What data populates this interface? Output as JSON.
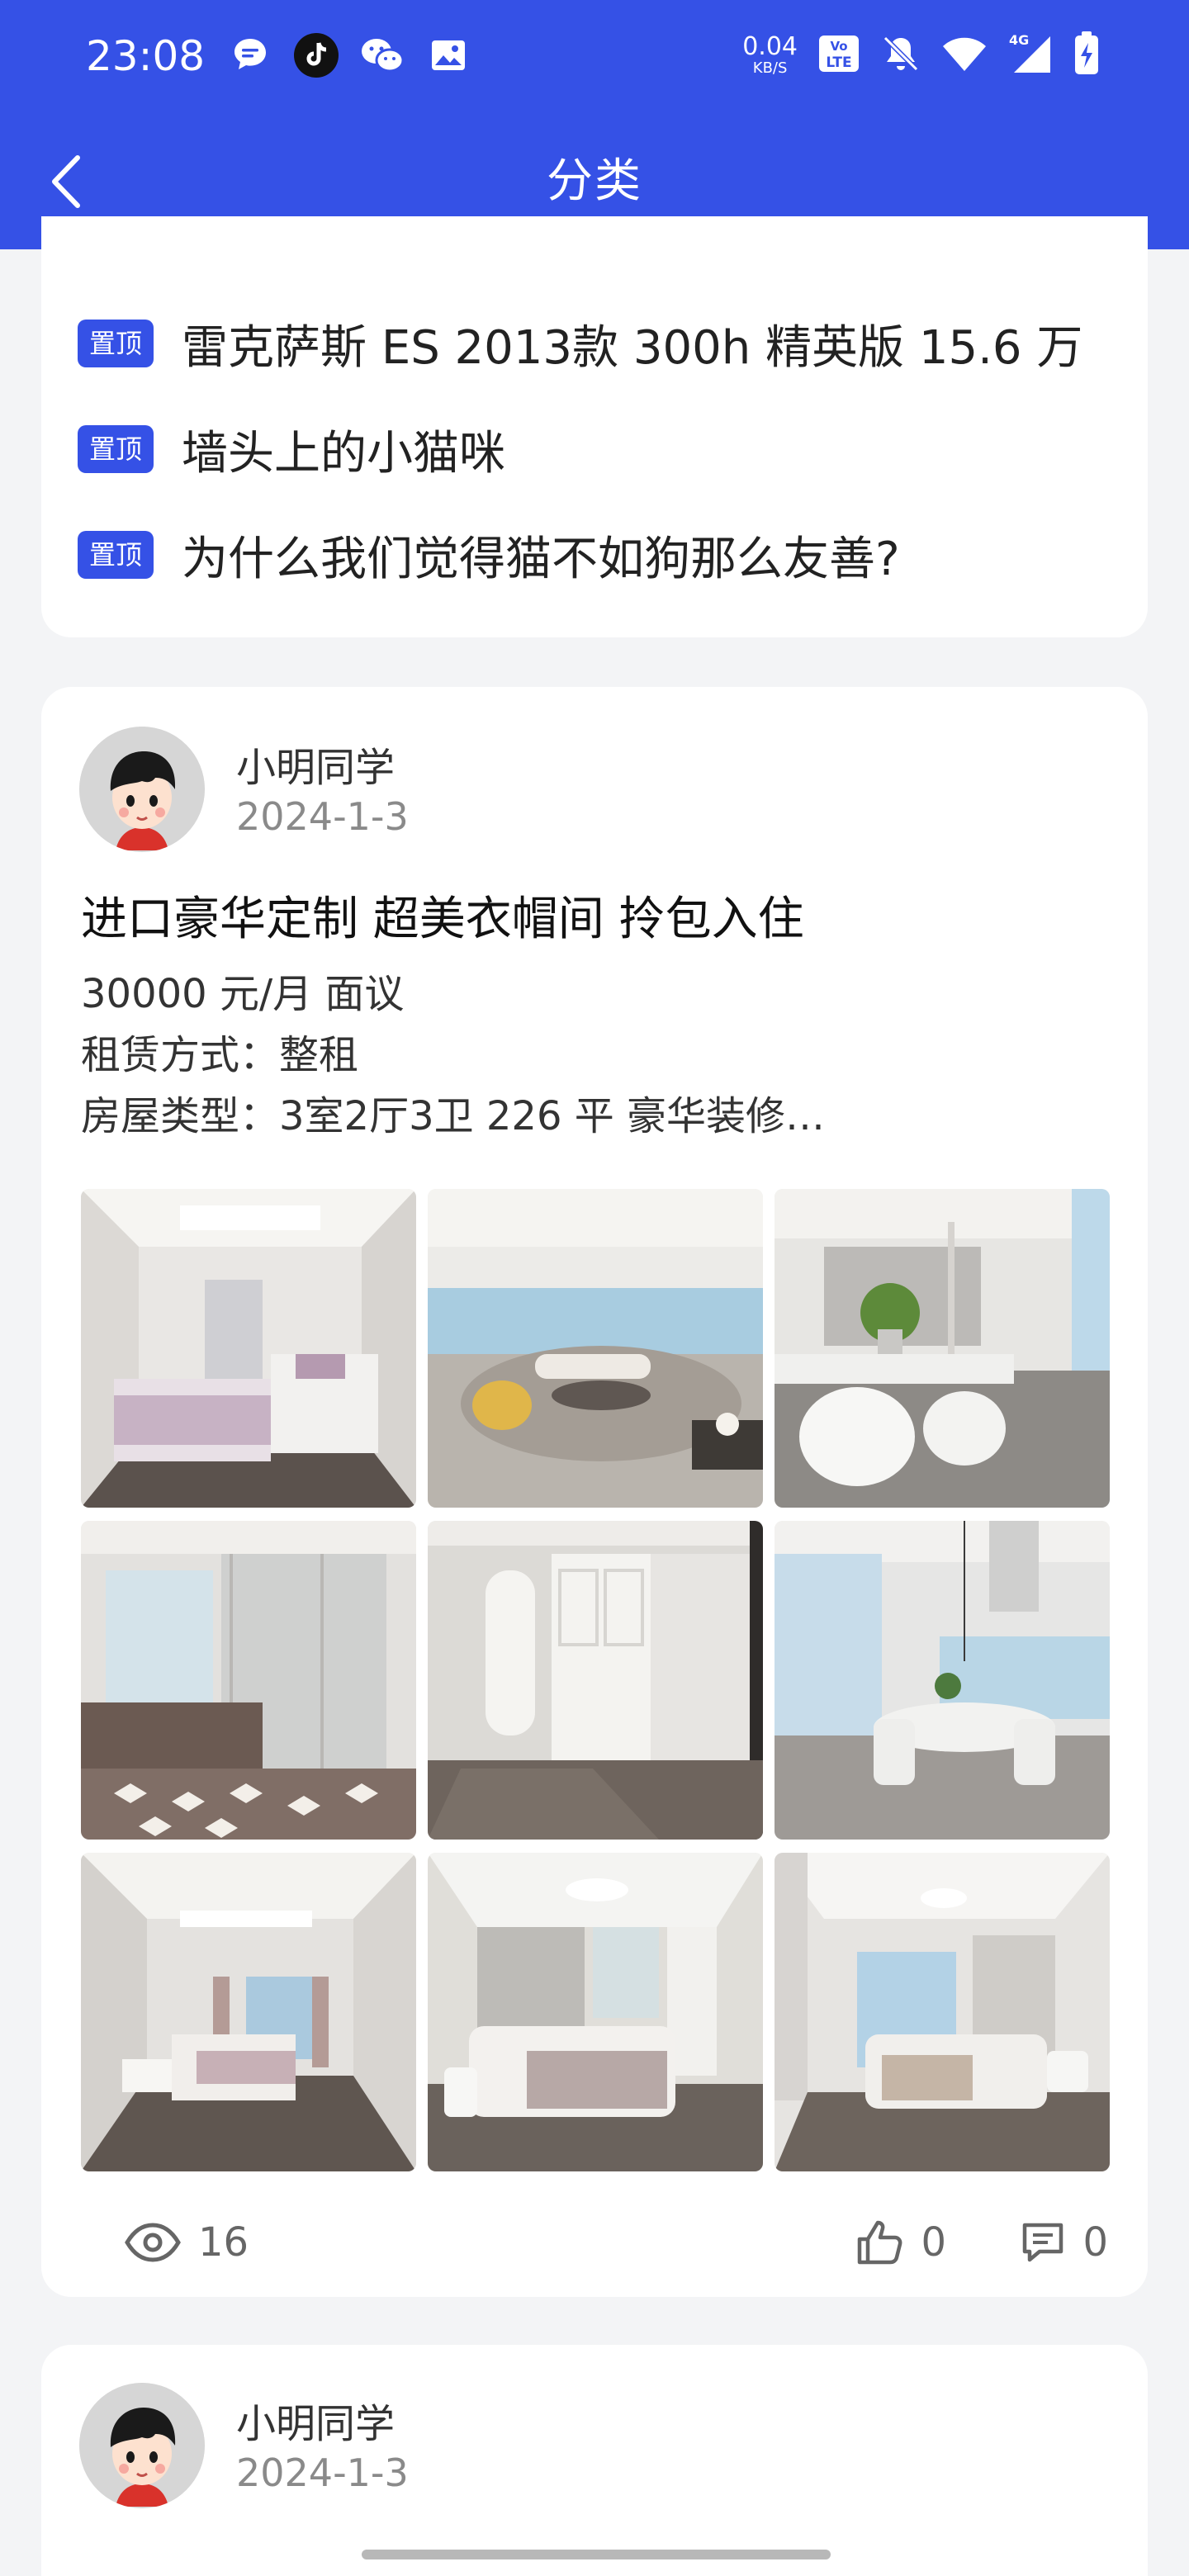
{
  "status": {
    "time": "23:08",
    "net_speed": "0.04",
    "net_unit": "KB/S",
    "volte": "Vo LTE",
    "net_type": "4G",
    "app_icons": [
      "message-icon",
      "tiktok-icon",
      "wechat-icon",
      "gallery-icon"
    ]
  },
  "nav": {
    "title": "分类"
  },
  "pinned": {
    "badge": "置顶",
    "items": [
      {
        "title": "雷克萨斯 ES 2013款 300h 精英版 15.6 万"
      },
      {
        "title": "墙头上的小猫咪"
      },
      {
        "title": "为什么我们觉得猫不如狗那么友善?"
      }
    ]
  },
  "posts": [
    {
      "author": "小明同学",
      "date": "2024-1-3",
      "title": "进口豪华定制 超美衣帽间 拎包入住",
      "lines": [
        "30000 元/月 面议",
        "租赁方式：整租",
        "房屋类型：3室2厅3卫 226 平 豪华装修…"
      ],
      "views": "16",
      "likes": "0",
      "comments": "0"
    },
    {
      "author": "小明同学",
      "date": "2024-1-3"
    }
  ],
  "colors": {
    "primary": "#3551e6",
    "background": "#f3f4f6"
  }
}
